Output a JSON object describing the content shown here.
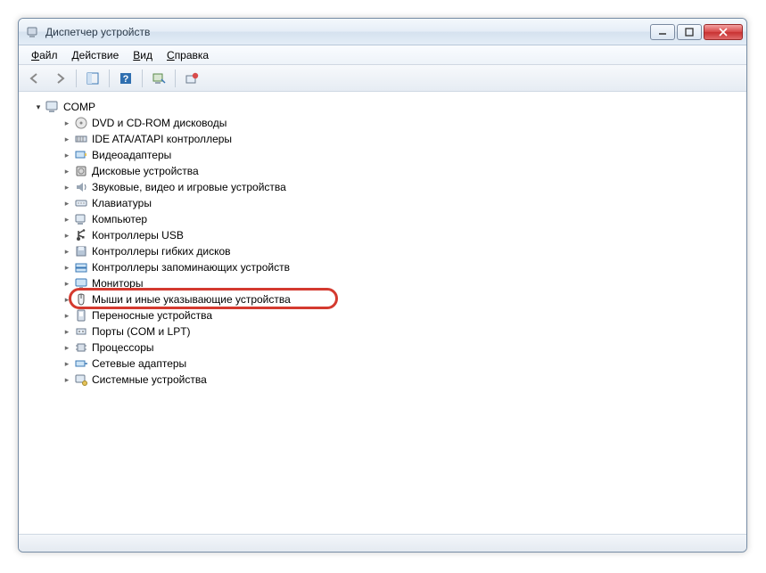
{
  "window": {
    "title": "Диспетчер устройств"
  },
  "menu": {
    "file": "Файл",
    "action": "Действие",
    "view": "Вид",
    "help": "Справка"
  },
  "tree": {
    "root": "COMP",
    "items": [
      {
        "id": "dvd",
        "label": "DVD и CD-ROM дисководы",
        "highlight": false
      },
      {
        "id": "ide",
        "label": "IDE ATA/ATAPI контроллеры",
        "highlight": false
      },
      {
        "id": "video",
        "label": "Видеоадаптеры",
        "highlight": false
      },
      {
        "id": "disk",
        "label": "Дисковые устройства",
        "highlight": false
      },
      {
        "id": "sound",
        "label": "Звуковые, видео и игровые устройства",
        "highlight": false
      },
      {
        "id": "keyboard",
        "label": "Клавиатуры",
        "highlight": false
      },
      {
        "id": "computer",
        "label": "Компьютер",
        "highlight": false
      },
      {
        "id": "usb",
        "label": "Контроллеры USB",
        "highlight": false
      },
      {
        "id": "floppy",
        "label": "Контроллеры гибких дисков",
        "highlight": false
      },
      {
        "id": "storage",
        "label": "Контроллеры запоминающих устройств",
        "highlight": false
      },
      {
        "id": "monitor",
        "label": "Мониторы",
        "highlight": false
      },
      {
        "id": "mouse",
        "label": "Мыши и иные указывающие устройства",
        "highlight": true
      },
      {
        "id": "portable",
        "label": "Переносные устройства",
        "highlight": false
      },
      {
        "id": "ports",
        "label": "Порты (COM и LPT)",
        "highlight": false
      },
      {
        "id": "cpu",
        "label": "Процессоры",
        "highlight": false
      },
      {
        "id": "net",
        "label": "Сетевые адаптеры",
        "highlight": false
      },
      {
        "id": "system",
        "label": "Системные устройства",
        "highlight": false
      }
    ]
  }
}
